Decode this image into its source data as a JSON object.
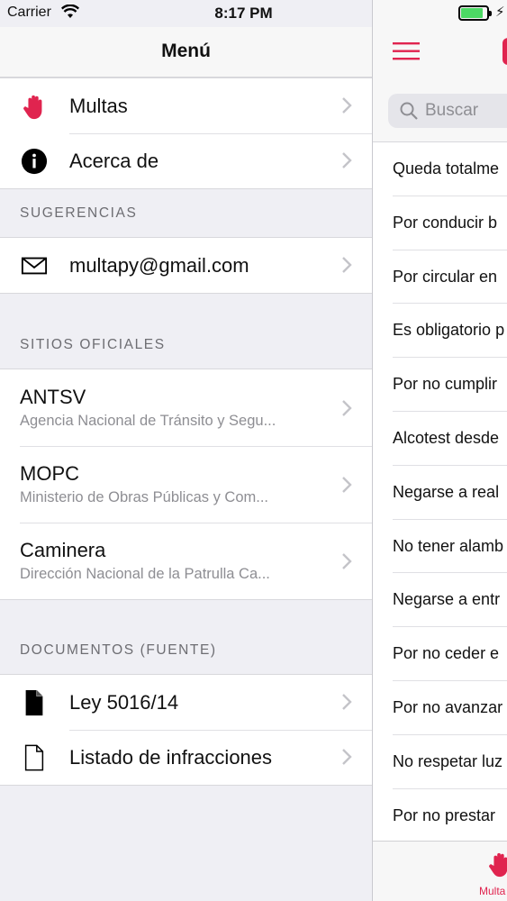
{
  "status_bar": {
    "carrier": "Carrier",
    "time": "8:17 PM"
  },
  "menu": {
    "title": "Menú",
    "items": [
      {
        "label": "Multas",
        "icon": "hand-stop-icon"
      },
      {
        "label": "Acerca de",
        "icon": "info-icon"
      }
    ],
    "sections": [
      {
        "header": "SUGERENCIAS",
        "rows": [
          {
            "label": "multapy@gmail.com",
            "icon": "envelope-icon"
          }
        ]
      },
      {
        "header": "SITIOS OFICIALES",
        "rows": [
          {
            "label": "ANTSV",
            "detail": "Agencia Nacional de Tránsito y Segu..."
          },
          {
            "label": "MOPC",
            "detail": "Ministerio de Obras Públicas y Com..."
          },
          {
            "label": "Caminera",
            "detail": "Dirección Nacional de la Patrulla Ca..."
          }
        ]
      },
      {
        "header": "DOCUMENTOS (FUENTE)",
        "rows": [
          {
            "label": "Ley 5016/14",
            "icon": "document-filled-icon"
          },
          {
            "label": "Listado de infracciones",
            "icon": "document-outline-icon"
          }
        ]
      }
    ]
  },
  "main": {
    "search_placeholder": "Buscar",
    "list_items": [
      "Queda totalme",
      "Por conducir b",
      "Por circular en",
      "Es obligatorio p",
      "Por no cumplir",
      "Alcotest desde",
      "Negarse a real",
      "No tener alamb",
      "Negarse a entr",
      "Por no ceder e",
      "Por no avanzar",
      "No respetar luz",
      "Por no prestar"
    ],
    "tab_label": "Multa",
    "battery_level": 0.85
  },
  "colors": {
    "accent": "#e0244f",
    "battery": "#4cd964",
    "secondary_text": "#8e8e93"
  }
}
